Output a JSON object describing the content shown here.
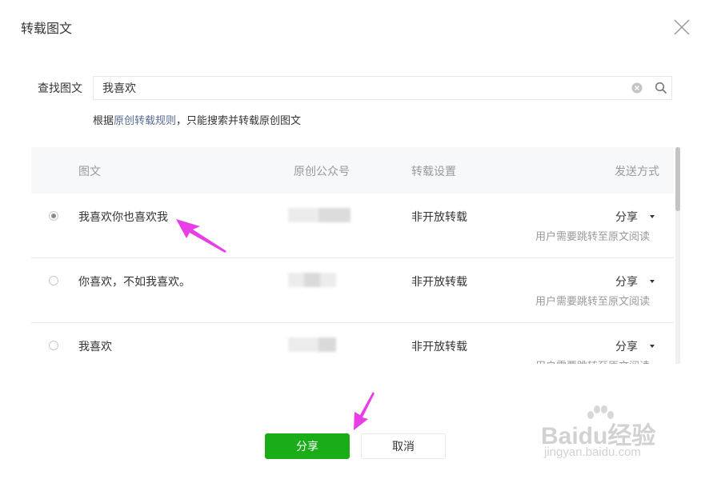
{
  "dialog": {
    "title": "转载图文",
    "close_icon": "close-icon"
  },
  "search": {
    "label": "查找图文",
    "value": "我喜欢",
    "clear_icon": "clear-circle-icon",
    "search_icon": "magnifier-icon"
  },
  "hint": {
    "prefix": "根据",
    "link": "原创转载规则",
    "suffix": "，只能搜索并转载原创图文"
  },
  "table": {
    "headers": {
      "article": "图文",
      "account": "原创公众号",
      "setting": "转载设置",
      "send_method": "发送方式"
    },
    "rows": [
      {
        "title": "我喜欢你也喜欢我",
        "setting": "非开放转载",
        "send": "分享",
        "send_note": "用户需要跳转至原文阅读",
        "selected": true
      },
      {
        "title": "你喜欢，不如我喜欢。",
        "setting": "非开放转载",
        "send": "分享",
        "send_note": "用户需要跳转至原文阅读",
        "selected": false
      },
      {
        "title": "我喜欢",
        "setting": "非开放转载",
        "send": "分享",
        "send_note": "用户需要跳转至原文阅读",
        "selected": false
      }
    ]
  },
  "buttons": {
    "share": "分享",
    "cancel": "取消"
  },
  "colors": {
    "primary": "#1aad19",
    "link": "#576b95",
    "annotation_arrow": "#e83ee6",
    "header_bg": "#f6f8f9"
  },
  "watermark": {
    "main": "Baidu经验",
    "sub": "jingyan.baidu.com"
  }
}
